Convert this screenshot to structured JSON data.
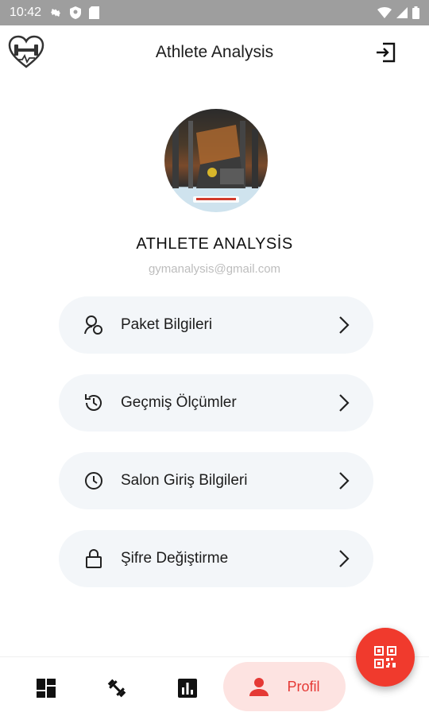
{
  "status_bar": {
    "time": "10:42",
    "left_icons": [
      "settings-icon",
      "shield-icon",
      "sim-card-icon"
    ],
    "right_icons": [
      "wifi-icon",
      "signal-icon",
      "battery-icon"
    ]
  },
  "app_bar": {
    "title": "Athlete Analysis",
    "logo_icon": "heart-dumbbell-logo-icon",
    "action_icon": "logout-icon"
  },
  "profile": {
    "name": "ATHLETE ANALYSİS",
    "email": "gymanalysis@gmail.com"
  },
  "menu": {
    "items": [
      {
        "label": "Paket Bilgileri",
        "icon": "package-info-icon"
      },
      {
        "label": "Geçmiş Ölçümler",
        "icon": "history-icon"
      },
      {
        "label": "Salon Giriş Bilgileri",
        "icon": "clock-icon"
      },
      {
        "label": "Şifre Değiştirme",
        "icon": "lock-icon"
      }
    ]
  },
  "fab": {
    "icon": "qr-code-icon"
  },
  "bottom_nav": {
    "items": [
      {
        "icon": "dashboard-icon"
      },
      {
        "icon": "fitness-icon"
      },
      {
        "icon": "bar-chart-icon"
      },
      {
        "icon": "person-icon",
        "label": "Profil",
        "active": true
      }
    ]
  },
  "colors": {
    "accent": "#f03a2d",
    "active_nav_bg": "#fde3e1",
    "menu_bg": "#f3f6f9",
    "status_bar": "#9e9e9e"
  }
}
